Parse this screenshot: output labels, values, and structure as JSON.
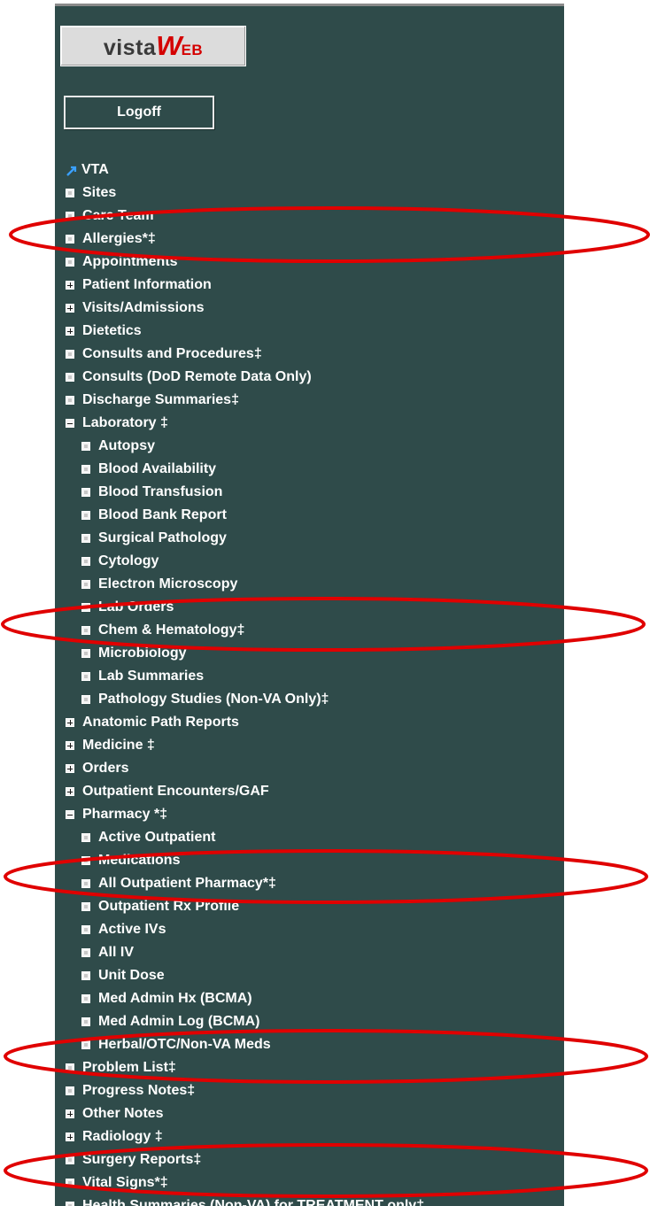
{
  "logo": {
    "prefix": "vista",
    "w": "W",
    "suffix": "EB"
  },
  "logoff_label": "Logoff",
  "nav": [
    {
      "label": "VTA",
      "icon": "external-link-icon",
      "level": 0
    },
    {
      "label": "Sites",
      "icon": "box-icon",
      "level": 0
    },
    {
      "label": "Care Team",
      "icon": "box-icon",
      "level": 0
    },
    {
      "label": "Allergies*‡",
      "icon": "box-icon",
      "level": 0
    },
    {
      "label": "Appointments",
      "icon": "box-icon",
      "level": 0
    },
    {
      "label": "Patient Information",
      "icon": "expand-plus-icon",
      "level": 0
    },
    {
      "label": "Visits/Admissions",
      "icon": "expand-plus-icon",
      "level": 0
    },
    {
      "label": "Dietetics",
      "icon": "expand-plus-icon",
      "level": 0
    },
    {
      "label": "Consults and Procedures‡",
      "icon": "box-icon",
      "level": 0
    },
    {
      "label": "Consults (DoD Remote Data Only)",
      "icon": "box-icon",
      "level": 0
    },
    {
      "label": "Discharge Summaries‡",
      "icon": "box-icon",
      "level": 0
    },
    {
      "label": "Laboratory ‡",
      "icon": "collapse-minus-icon",
      "level": 0
    },
    {
      "label": "Autopsy",
      "icon": "box-icon",
      "level": 1
    },
    {
      "label": "Blood Availability",
      "icon": "box-icon",
      "level": 1
    },
    {
      "label": "Blood Transfusion",
      "icon": "box-icon",
      "level": 1
    },
    {
      "label": "Blood Bank Report",
      "icon": "box-icon",
      "level": 1
    },
    {
      "label": "Surgical Pathology",
      "icon": "box-icon",
      "level": 1
    },
    {
      "label": "Cytology",
      "icon": "box-icon",
      "level": 1
    },
    {
      "label": "Electron Microscopy",
      "icon": "box-icon",
      "level": 1
    },
    {
      "label": "Lab Orders",
      "icon": "box-icon",
      "level": 1
    },
    {
      "label": "Chem & Hematology‡",
      "icon": "box-icon",
      "level": 1
    },
    {
      "label": "Microbiology",
      "icon": "box-icon",
      "level": 1
    },
    {
      "label": "Lab Summaries",
      "icon": "box-icon",
      "level": 1
    },
    {
      "label": "Pathology Studies (Non-VA Only)‡",
      "icon": "box-icon",
      "level": 1
    },
    {
      "label": "Anatomic Path Reports",
      "icon": "expand-plus-icon",
      "level": 0
    },
    {
      "label": "Medicine ‡",
      "icon": "expand-plus-icon",
      "level": 0
    },
    {
      "label": "Orders",
      "icon": "expand-plus-icon",
      "level": 0
    },
    {
      "label": "Outpatient Encounters/GAF",
      "icon": "expand-plus-icon",
      "level": 0
    },
    {
      "label": "Pharmacy *‡",
      "icon": "collapse-minus-icon",
      "level": 0
    },
    {
      "label": "Active Outpatient",
      "icon": "box-icon",
      "level": 1
    },
    {
      "label": "Medications",
      "icon": "box-icon",
      "level": 1
    },
    {
      "label": "All Outpatient Pharmacy*‡",
      "icon": "box-icon",
      "level": 1
    },
    {
      "label": "Outpatient Rx Profile",
      "icon": "box-icon",
      "level": 1
    },
    {
      "label": "Active IVs",
      "icon": "box-icon",
      "level": 1
    },
    {
      "label": "All IV",
      "icon": "box-icon",
      "level": 1
    },
    {
      "label": "Unit Dose",
      "icon": "box-icon",
      "level": 1
    },
    {
      "label": "Med Admin Hx (BCMA)",
      "icon": "box-icon",
      "level": 1
    },
    {
      "label": "Med Admin Log (BCMA)",
      "icon": "box-icon",
      "level": 1
    },
    {
      "label": "Herbal/OTC/Non-VA Meds",
      "icon": "box-icon",
      "level": 1
    },
    {
      "label": "Problem List‡",
      "icon": "box-icon",
      "level": 0
    },
    {
      "label": "Progress Notes‡",
      "icon": "box-icon",
      "level": 0
    },
    {
      "label": "Other Notes",
      "icon": "expand-plus-icon",
      "level": 0
    },
    {
      "label": "Radiology ‡",
      "icon": "expand-plus-icon",
      "level": 0
    },
    {
      "label": "Surgery Reports‡",
      "icon": "box-icon",
      "level": 0
    },
    {
      "label": "Vital Signs*‡",
      "icon": "box-icon",
      "level": 0
    },
    {
      "label": "Health Summaries (Non-VA) for TREATMENT only‡",
      "icon": "box-icon",
      "level": 0
    }
  ],
  "annotation_color": "#e00000",
  "highlighted_items": [
    "Allergies*‡",
    "Chem & Hematology‡",
    "All Outpatient Pharmacy*‡",
    "Problem List‡",
    "Vital Signs*‡"
  ]
}
